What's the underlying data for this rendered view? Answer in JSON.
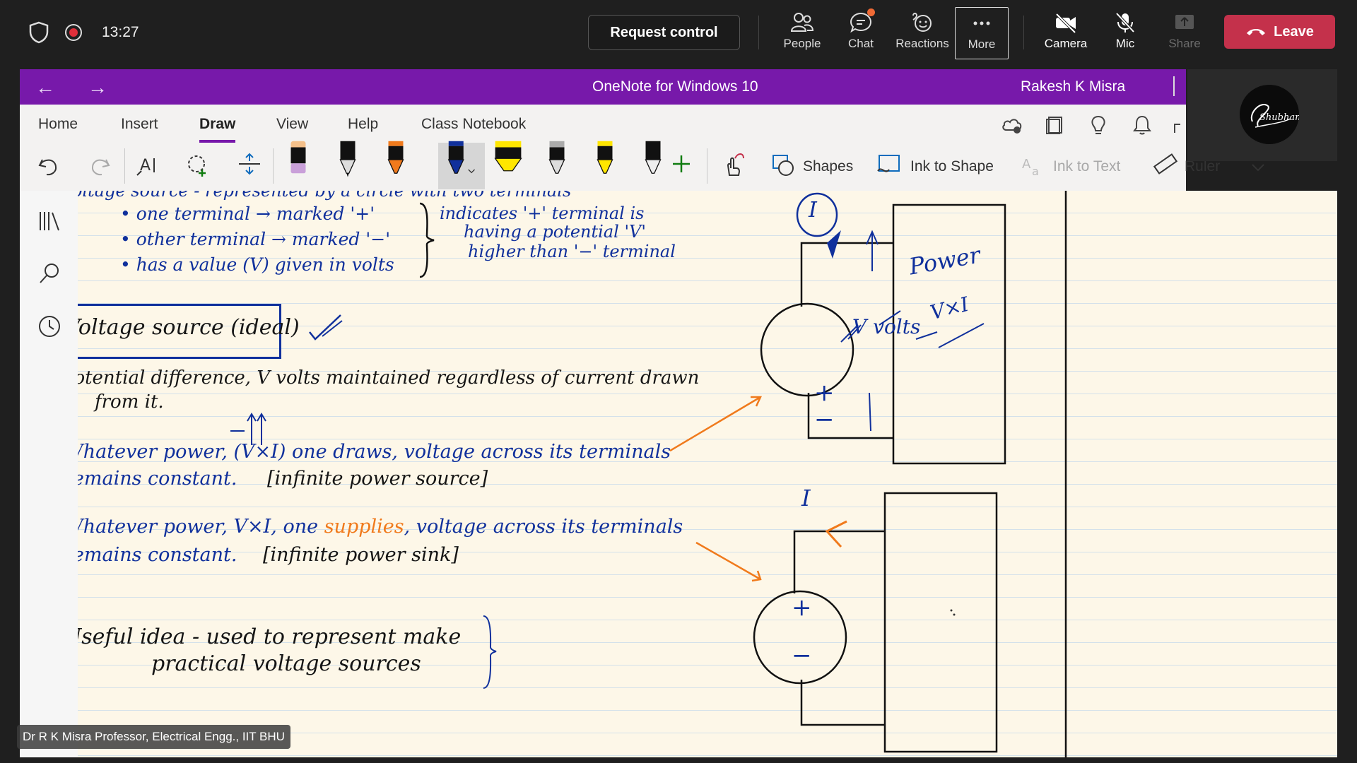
{
  "meeting": {
    "time": "13:27",
    "request_control_label": "Request control",
    "buttons": [
      {
        "label": "People",
        "icon": "people-icon"
      },
      {
        "label": "Chat",
        "icon": "chat-icon"
      },
      {
        "label": "Reactions",
        "icon": "reactions-icon"
      },
      {
        "label": "More",
        "icon": "more-icon"
      },
      {
        "label": "Camera",
        "icon": "camera-off-icon"
      },
      {
        "label": "Mic",
        "icon": "mic-off-icon"
      },
      {
        "label": "Share",
        "icon": "share-icon"
      }
    ],
    "leave_label": "Leave",
    "leave_color": "#c4314b",
    "presenter_caption": "Dr R K Misra Professor, Electrical Engg., IIT BHU",
    "self_view_signature": "Shubham"
  },
  "onenote": {
    "app_title": "OneNote for Windows 10",
    "user_name": "Rakesh K Misra",
    "accent_color": "#7719aa",
    "tabs": [
      "Home",
      "Insert",
      "Draw",
      "View",
      "Help",
      "Class Notebook"
    ],
    "active_tab": "Draw",
    "tools": {
      "shapes": "Shapes",
      "ink_to_shape": "Ink to Shape",
      "ink_to_text": "Ink to Text",
      "ruler": "Ruler"
    }
  },
  "notes": {
    "top_partial": "oltage source - represented by a circle with two terminals",
    "bullets": [
      "• one terminal → marked '+'",
      "• other terminal → marked '−'",
      "• has a value (V) given in volts"
    ],
    "bracket_note": [
      "indicates '+' terminal is",
      "having a potential 'V'",
      "higher than '−' terminal"
    ],
    "box_title": "Voltage source (ideal)",
    "definition": [
      "Potential difference, V volts maintained regardless of current drawn",
      "from it."
    ],
    "case1": [
      "Whatever power, (V×I) one draws, voltage across its terminals",
      "remains constant.",
      "[infinite power source]"
    ],
    "case2_parts": [
      "Whatever power, V×I, one",
      "supplies",
      ", voltage across its terminals"
    ],
    "case2": [
      "remains constant.",
      "[infinite power sink]"
    ],
    "usefulness": [
      "Useful idea - used to represent make",
      "practical voltage sources"
    ],
    "circuit1": {
      "current": "I",
      "voltage": "V volts",
      "box_label": "Power",
      "formula": "V×I"
    },
    "circuit2": {
      "current": "I"
    },
    "plus": "+",
    "minus": "−"
  }
}
